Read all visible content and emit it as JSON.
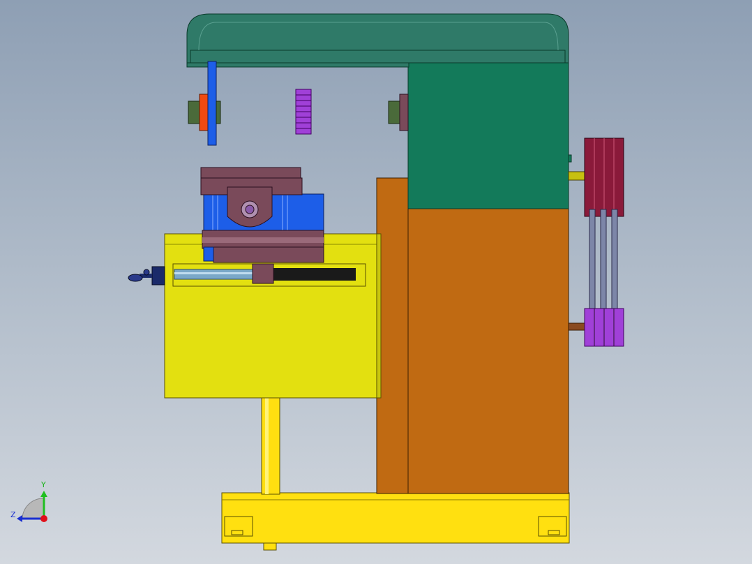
{
  "app": {
    "view": "cad-3d-viewport"
  },
  "triad": {
    "y_label": "Y",
    "z_label": "Z",
    "colors": {
      "y": "#1fbf1f",
      "z": "#1a2fd0",
      "x": "#e0101a"
    }
  },
  "model": {
    "colors": {
      "head": "#2f7a68",
      "headbox": "#137a5a",
      "column": "#c06a12",
      "table": "#e3e010",
      "base": "#ffe010",
      "vise_body": "#1d5ee8",
      "vise_jaw": "#7a4a5a",
      "gear": "#a040d8",
      "pulley": "#8a1a3a",
      "belt": "#7d86a8"
    },
    "icons": [
      "handwheel-icon",
      "pulley-icon",
      "gear-icon",
      "lead-screw-icon"
    ]
  }
}
